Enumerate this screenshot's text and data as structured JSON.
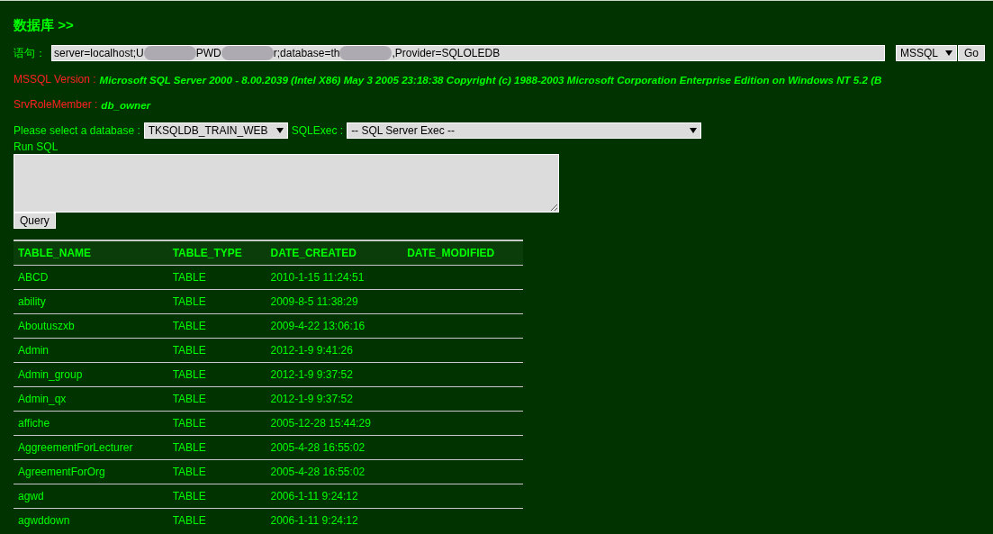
{
  "heading": "数据库 >>",
  "connection": {
    "label": "语句：",
    "parts": [
      {
        "kind": "text",
        "text": "server=localhost;U"
      },
      {
        "kind": "redacted"
      },
      {
        "kind": "text",
        "text": "PWD"
      },
      {
        "kind": "redacted"
      },
      {
        "kind": "text",
        "text": "r;database=th"
      },
      {
        "kind": "redacted"
      },
      {
        "kind": "text",
        "text": ",Provider=SQLOLEDB"
      }
    ],
    "db_type": "MSSQL",
    "go": "Go"
  },
  "info": [
    {
      "label": "MSSQL Version :",
      "value": "Microsoft SQL Server 2000 - 8.00.2039 (Intel X86) May 3 2005 23:18:38 Copyright (c) 1988-2003 Microsoft Corporation Enterprise Edition on Windows NT 5.2 (B"
    },
    {
      "label": "SrvRoleMember :",
      "value": "db_owner"
    }
  ],
  "database_select": {
    "label": "Please select a database :",
    "value": "TKSQLDB_TRAIN_WEB"
  },
  "sqlexec_select": {
    "label": "SQLExec :",
    "value": "-- SQL Server Exec --"
  },
  "run_sql": {
    "label": "Run SQL",
    "button": "Query"
  },
  "table": {
    "columns": [
      "TABLE_NAME",
      "TABLE_TYPE",
      "DATE_CREATED",
      "DATE_MODIFIED"
    ],
    "rows": [
      [
        "ABCD",
        "TABLE",
        "2010-1-15 11:24:51"
      ],
      [
        "ability",
        "TABLE",
        "2009-8-5 11:38:29"
      ],
      [
        "Aboutuszxb",
        "TABLE",
        "2009-4-22 13:06:16"
      ],
      [
        "Admin",
        "TABLE",
        "2012-1-9 9:41:26"
      ],
      [
        "Admin_group",
        "TABLE",
        "2012-1-9 9:37:52"
      ],
      [
        "Admin_qx",
        "TABLE",
        "2012-1-9 9:37:52"
      ],
      [
        "affiche",
        "TABLE",
        "2005-12-28 15:44:29"
      ],
      [
        "AggreementForLecturer",
        "TABLE",
        "2005-4-28 16:55:02"
      ],
      [
        "AgreementForOrg",
        "TABLE",
        "2005-4-28 16:55:02"
      ],
      [
        "agwd",
        "TABLE",
        "2006-1-11 9:24:12"
      ],
      [
        "agwddown",
        "TABLE",
        "2006-1-11 9:24:12"
      ]
    ]
  }
}
